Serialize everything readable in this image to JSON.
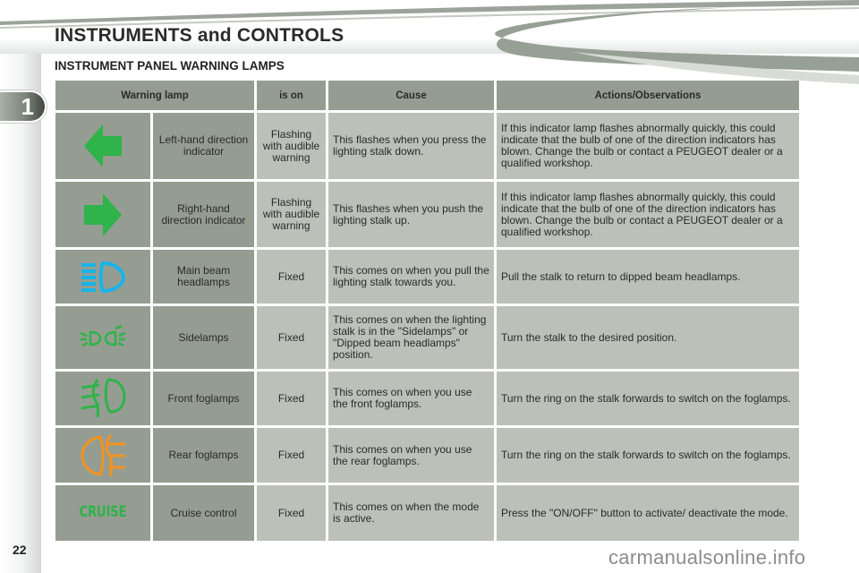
{
  "header": {
    "title": "INSTRUMENTS and CONTROLS"
  },
  "section": {
    "title": "INSTRUMENT PANEL WARNING LAMPS"
  },
  "chapter_tab": {
    "number": "1"
  },
  "page": {
    "number": "22"
  },
  "watermark": "carmanualsonline.info",
  "colors": {
    "header_cell": "#959d92",
    "light_cell": "#bcc0b9",
    "green_lamp": "#2fb34a",
    "blue_lamp": "#17b4e8",
    "orange_lamp": "#f39320"
  },
  "table": {
    "columns": [
      "Warning lamp",
      "is on",
      "Cause",
      "Actions/Observations"
    ],
    "rows": [
      {
        "icon": "left-arrow-icon",
        "name": "Left-hand direction indicator",
        "is_on": "Flashing with audible warning",
        "cause": "This flashes when you press the lighting stalk down.",
        "action": "If this indicator lamp flashes abnormally quickly, this could indicate that the bulb of one of the direction indicators has blown. Change the bulb or contact a PEUGEOT dealer or a qualified workshop."
      },
      {
        "icon": "right-arrow-icon",
        "name": "Right-hand direction indicator",
        "is_on": "Flashing with audible warning",
        "cause": "This flashes when you push the lighting stalk up.",
        "action": "If this indicator lamp flashes abnormally quickly, this could indicate that the bulb of one of the direction indicators has blown. Change the bulb or contact a PEUGEOT dealer or a qualified workshop."
      },
      {
        "icon": "main-beam-icon",
        "name": "Main beam headlamps",
        "is_on": "Fixed",
        "cause": "This comes on when you pull the lighting stalk towards you.",
        "action": "Pull the stalk to return to dipped beam headlamps."
      },
      {
        "icon": "sidelamps-icon",
        "name": "Sidelamps",
        "is_on": "Fixed",
        "cause": "This comes on when the lighting stalk is in the \"Sidelamps\" or \"Dipped beam headlamps\" position.",
        "action": "Turn the stalk to the desired position."
      },
      {
        "icon": "front-foglamp-icon",
        "name": "Front foglamps",
        "is_on": "Fixed",
        "cause": "This comes on when you use the front foglamps.",
        "action": "Turn the ring on the stalk forwards to switch on the foglamps."
      },
      {
        "icon": "rear-foglamp-icon",
        "name": "Rear foglamps",
        "is_on": "Fixed",
        "cause": "This comes on when you use the rear foglamps.",
        "action": "Turn the ring on the stalk forwards to switch on the foglamps."
      },
      {
        "icon": "cruise-control-icon",
        "name": "Cruise control",
        "is_on": "Fixed",
        "cause": "This comes on when the mode is active.",
        "action": "Press the \"ON/OFF\" button to activate/ deactivate the mode.",
        "icon_text": "CRUISE"
      }
    ]
  }
}
